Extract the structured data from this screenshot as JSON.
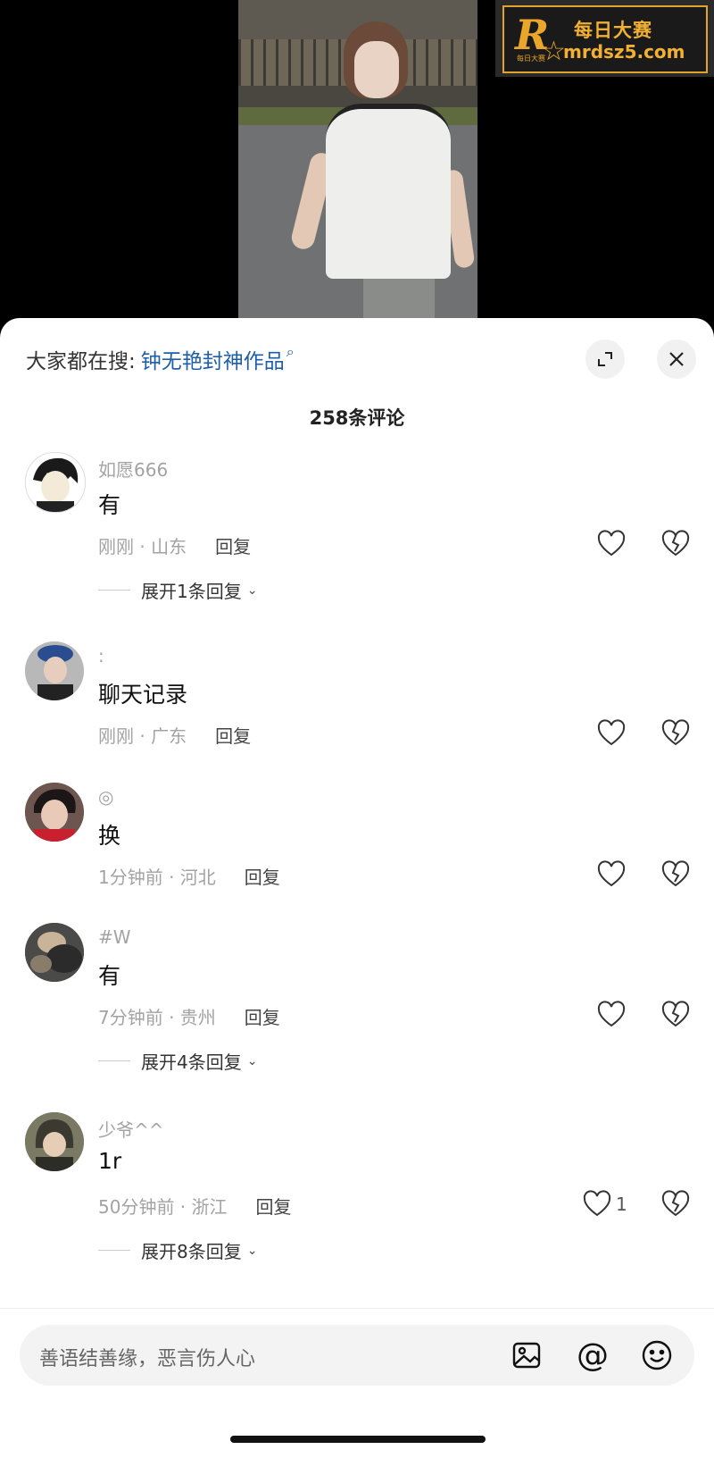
{
  "watermark": {
    "logo_letter": "R",
    "logo_caption": "每日大赛",
    "title": "每日大赛",
    "url": "mrdsz5.com"
  },
  "search_bar": {
    "prefix": "大家都在搜:",
    "term": "钟无艳封神作品"
  },
  "comment_count": "258条评论",
  "comments": [
    {
      "username": "如愿666",
      "text": "有",
      "time_location": "刚刚 · 山东",
      "reply_label": "回复",
      "likes": "",
      "expand_label": "展开1条回复"
    },
    {
      "username": ":",
      "text": "聊天记录",
      "time_location": "刚刚 · 广东",
      "reply_label": "回复",
      "likes": "",
      "expand_label": ""
    },
    {
      "username": "◎",
      "text": "换",
      "time_location": "1分钟前 · 河北",
      "reply_label": "回复",
      "likes": "",
      "expand_label": ""
    },
    {
      "username": "#W",
      "text": "有",
      "time_location": "7分钟前 · 贵州",
      "reply_label": "回复",
      "likes": "",
      "expand_label": "展开4条回复"
    },
    {
      "username": "少爷^^",
      "text": "1r",
      "time_location": "50分钟前 · 浙江",
      "reply_label": "回复",
      "likes": "1",
      "expand_label": "展开8条回复"
    }
  ],
  "input": {
    "placeholder": "善语结善缘，恶言伤人心",
    "at_symbol": "@"
  },
  "colors": {
    "search_term": "#1f5fa8",
    "watermark_gold": "#f1b034"
  }
}
